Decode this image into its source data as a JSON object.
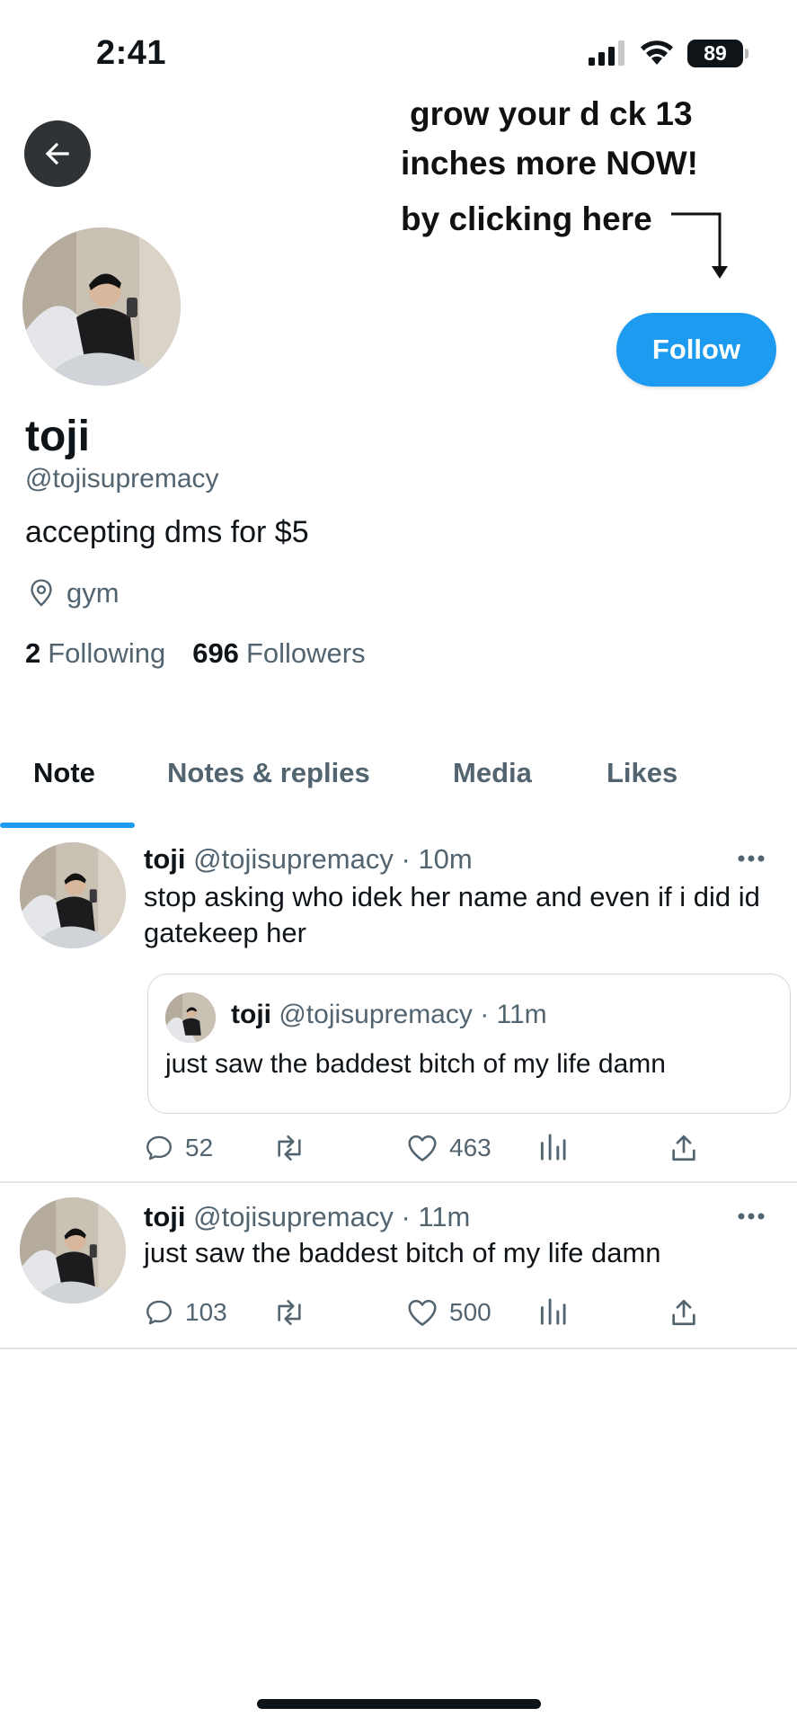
{
  "status_bar": {
    "time": "2:41",
    "battery": "89"
  },
  "header": {
    "promo_line1": "grow your d ck 13",
    "promo_line2": "inches more NOW!",
    "promo_line3": "by clicking here"
  },
  "profile": {
    "name": "toji",
    "handle": "@tojisupremacy",
    "bio": "accepting dms for $5",
    "location": "gym",
    "following_count": "2",
    "following_label": "Following",
    "followers_count": "696",
    "followers_label": "Followers",
    "follow_button": "Follow"
  },
  "tabs": [
    {
      "label": "Note",
      "active": true
    },
    {
      "label": "Notes & replies",
      "active": false
    },
    {
      "label": "Media",
      "active": false
    },
    {
      "label": "Likes",
      "active": false
    }
  ],
  "posts": [
    {
      "name": "toji",
      "meta": "@tojisupremacy · 10m",
      "text": "stop asking who idek her name and even if i did id gatekeep her",
      "quote": {
        "name": "toji",
        "meta": "@tojisupremacy · 11m",
        "text": "just saw the baddest bitch of my life damn"
      },
      "replies": "52",
      "likes": "463"
    },
    {
      "name": "toji",
      "meta": "@tojisupremacy · 11m",
      "text": "just saw the baddest bitch of my life damn",
      "replies": "103",
      "likes": "500"
    }
  ],
  "colors": {
    "accent": "#1d9bf0",
    "secondary_text": "#536471",
    "primary_text": "#0f1419"
  }
}
